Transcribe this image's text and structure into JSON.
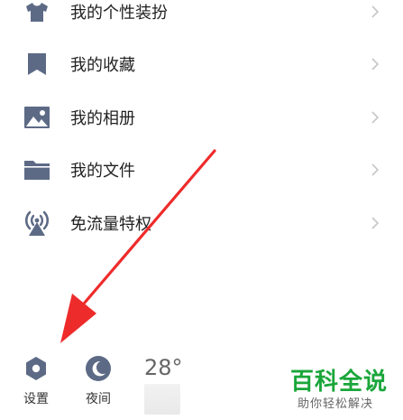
{
  "menu": {
    "items": [
      {
        "label": "我的个性装扮",
        "icon": "tshirt-icon"
      },
      {
        "label": "我的收藏",
        "icon": "bookmark-icon"
      },
      {
        "label": "我的相册",
        "icon": "image-icon"
      },
      {
        "label": "我的文件",
        "icon": "folder-icon"
      },
      {
        "label": "免流量特权",
        "icon": "antenna-icon"
      }
    ],
    "icon_color": "#5d6a86"
  },
  "bottom": {
    "settings_label": "设置",
    "night_label": "夜间",
    "temperature": "28°"
  },
  "watermark": {
    "title": "百科全说",
    "subtitle": "助你轻松解决"
  },
  "colors": {
    "arrow": "#ee2b2b",
    "watermark_green": "#1aa63a"
  }
}
